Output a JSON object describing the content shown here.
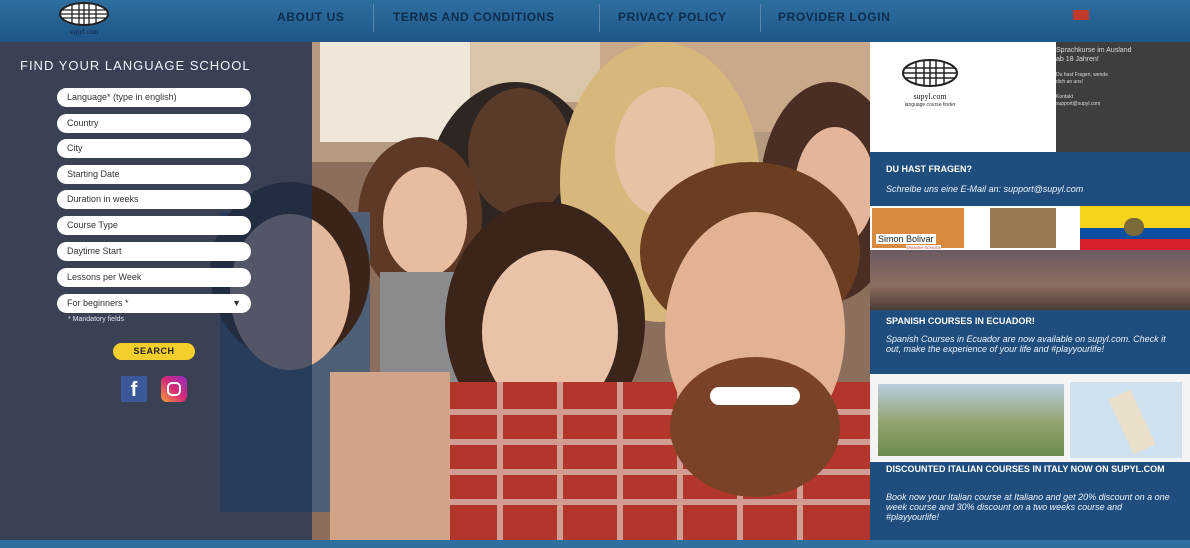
{
  "logo": {
    "text": "supyl.com"
  },
  "nav": [
    "ABOUT US",
    "TERMS AND CONDITIONS",
    "PRIVACY POLICY",
    "PROVIDER LOGIN"
  ],
  "sidebar": {
    "title": "FIND YOUR LANGUAGE SCHOOL",
    "fields": [
      "Language* (type in english)",
      "Country",
      "City",
      "Starting Date",
      "Duration in weeks",
      "Course Type",
      "Daytime Start",
      "Lessons per Week"
    ],
    "select": "For beginners *",
    "mandatory": "* Mandatory fields",
    "search": "SEARCH"
  },
  "right": {
    "card": {
      "logo_text": "supyl.com",
      "logo_sub": "language course finder",
      "lines": [
        "Sprachkurse im Ausland",
        "ab 18 Jahren!",
        "Du hast Fragen, wende",
        "dich an uns!",
        "Kontakt",
        "support@supyl.com"
      ]
    },
    "heading1": "DU HAST FRAGEN?",
    "text1": "Schreibe uns eine E-Mail an: support@supyl.com",
    "school": {
      "name": "Simon Bolivar",
      "sub": "SPANISH SCHOOL"
    },
    "heading2": "SPANISH COURSES IN ECUADOR!",
    "text2": "Spanish Courses in Ecuador are now available on supyl.com. Check it out, make the experience of your life and #playyourlife!",
    "heading3": "DISCOUNTED ITALIAN COURSES IN ITALY NOW ON SUPYL.COM",
    "text3": "Book now your Italian course at Italiano and get 20% discount on a one week course and 30% discount on a two weeks course and #playyourlife!"
  }
}
